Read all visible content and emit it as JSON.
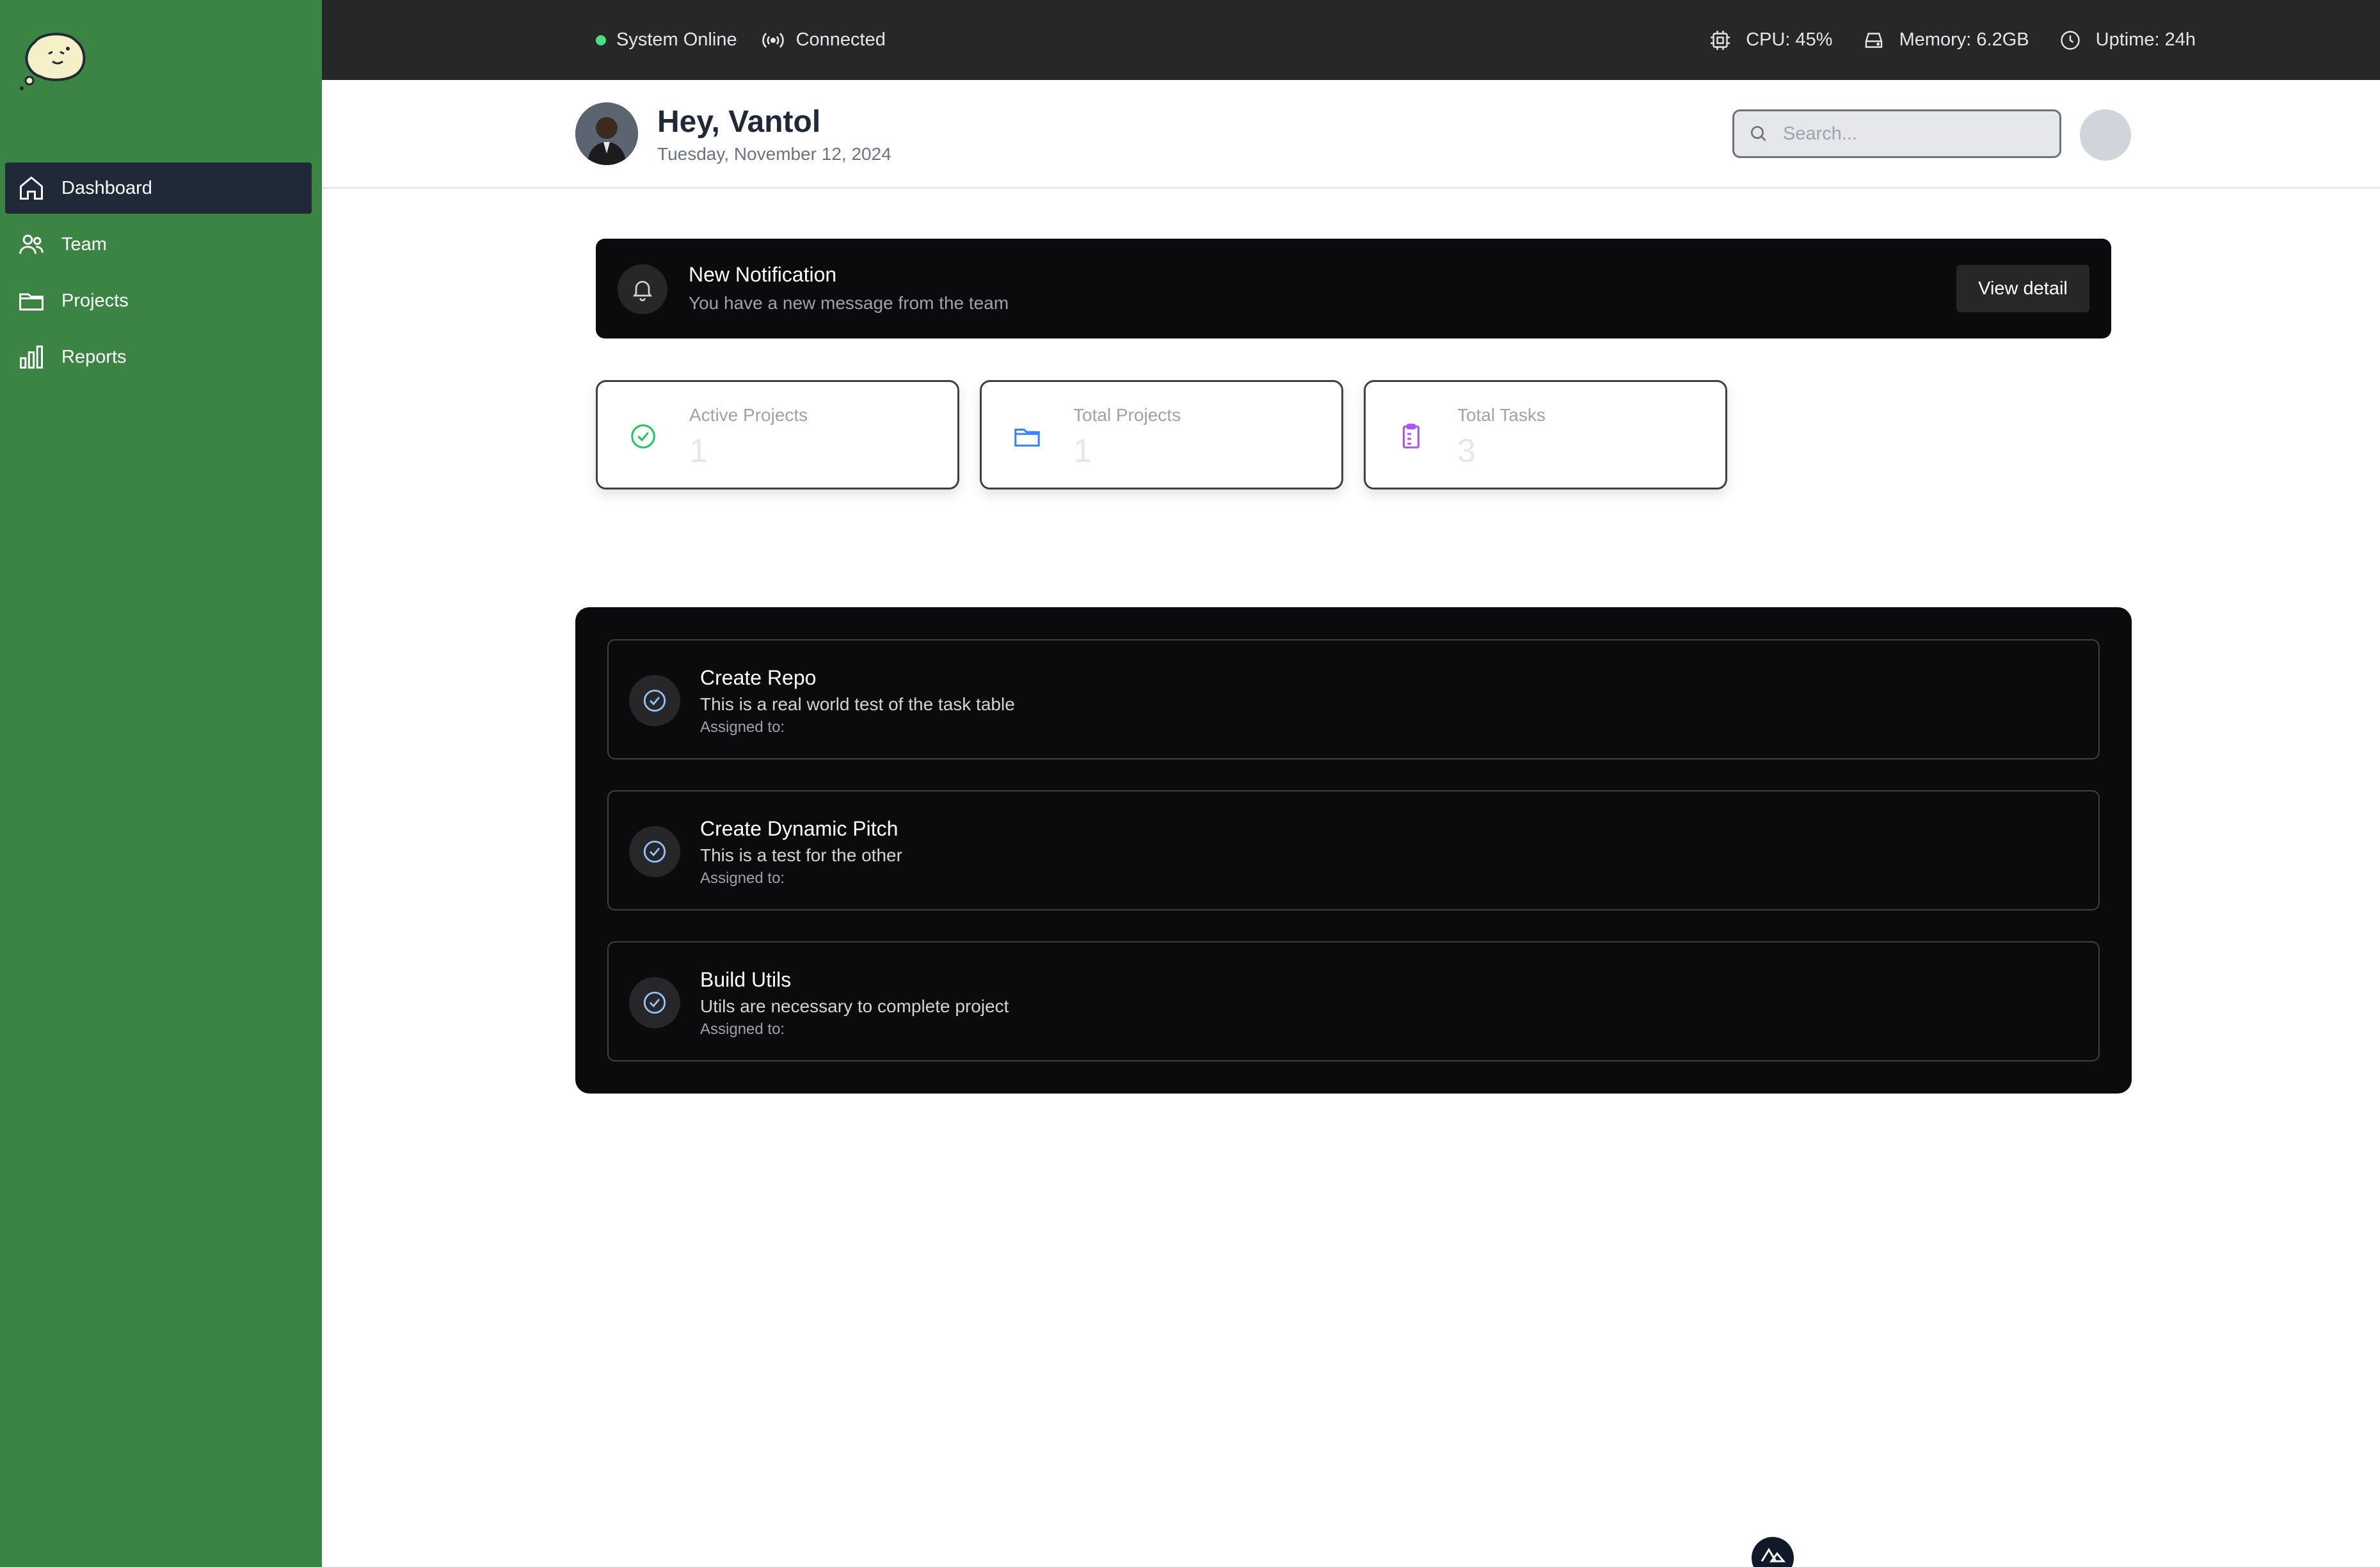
{
  "sidebar": {
    "items": [
      {
        "label": "Dashboard",
        "icon": "home-icon",
        "active": true
      },
      {
        "label": "Team",
        "icon": "users-icon",
        "active": false
      },
      {
        "label": "Projects",
        "icon": "folder-icon",
        "active": false
      },
      {
        "label": "Reports",
        "icon": "bar-chart-icon",
        "active": false
      }
    ]
  },
  "status": {
    "online": "System Online",
    "connection": "Connected",
    "cpu": "CPU: 45%",
    "memory": "Memory: 6.2GB",
    "uptime": "Uptime: 24h"
  },
  "header": {
    "greeting": "Hey, Vantol",
    "date": "Tuesday, November 12, 2024",
    "search_placeholder": "Search..."
  },
  "notification": {
    "title": "New Notification",
    "body": "You have a new message from the team",
    "button": "View detail"
  },
  "stats": [
    {
      "label": "Active Projects",
      "value": "1",
      "icon": "check-circle-icon",
      "color": "#22c55e"
    },
    {
      "label": "Total Projects",
      "value": "1",
      "icon": "folder-icon",
      "color": "#3b82f6"
    },
    {
      "label": "Total Tasks",
      "value": "3",
      "icon": "clipboard-icon",
      "color": "#a855f7"
    }
  ],
  "tasks": [
    {
      "title": "Create Repo",
      "description": "This is a real world test of the task table",
      "assigned": "Assigned to:"
    },
    {
      "title": "Create Dynamic Pitch",
      "description": "This is a test for the other",
      "assigned": "Assigned to:"
    },
    {
      "title": "Build Utils",
      "description": "Utils are necessary to complete project",
      "assigned": "Assigned to:"
    }
  ],
  "colors": {
    "sidebar": "#3c8443",
    "statusbar": "#272727",
    "online_dot": "#4ade80",
    "panel": "#0b0b0d"
  }
}
